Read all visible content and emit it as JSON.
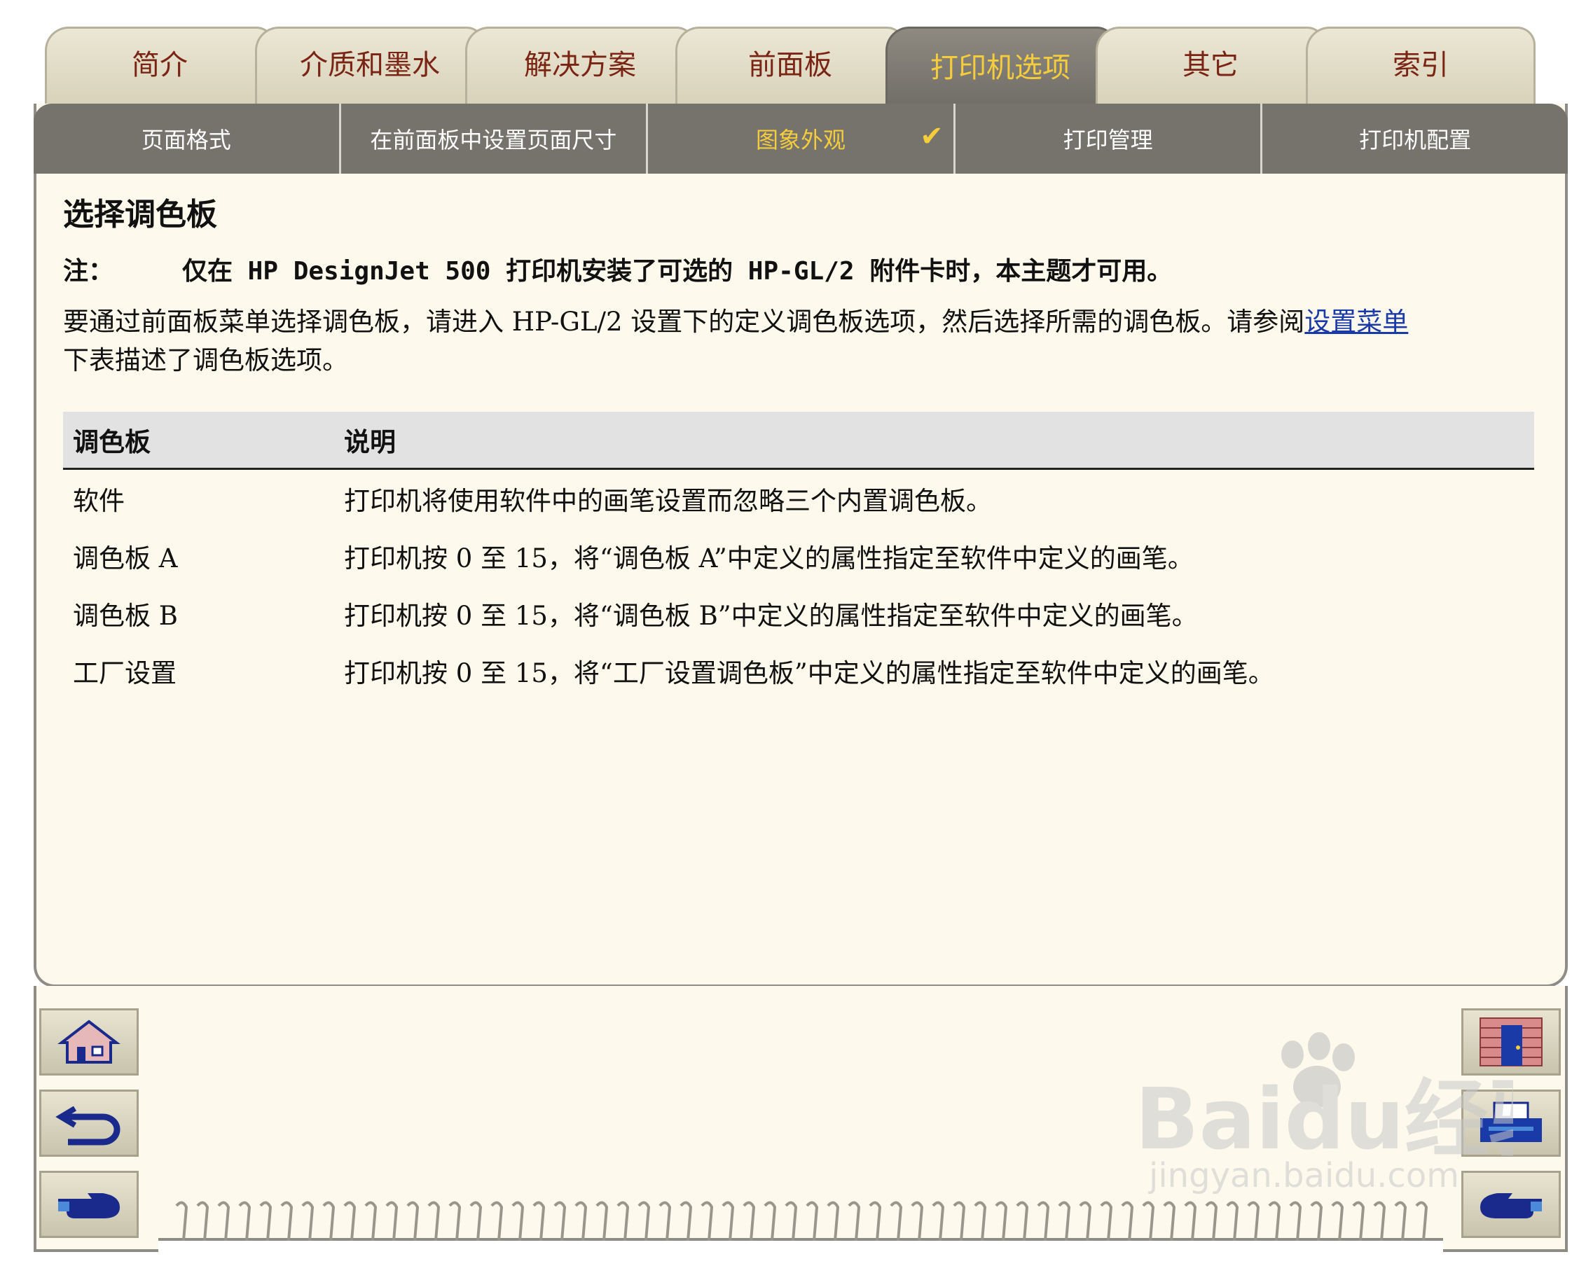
{
  "tabs": [
    {
      "label": "简介"
    },
    {
      "label": "介质和墨水"
    },
    {
      "label": "解决方案"
    },
    {
      "label": "前面板"
    },
    {
      "label": "打印机选项"
    },
    {
      "label": "其它"
    },
    {
      "label": "索引"
    }
  ],
  "subnav": [
    {
      "label": "页面格式"
    },
    {
      "label": "在前面板中设置页面尺寸"
    },
    {
      "label": "图象外观"
    },
    {
      "label": "打印管理"
    },
    {
      "label": "打印机配置"
    }
  ],
  "check_mark": "✔",
  "page": {
    "title": "选择调色板",
    "note_label": "注：",
    "note_text": "仅在 HP DesignJet 500 打印机安装了可选的 HP-GL/2 附件卡时，本主题才可用。",
    "para1_text": "要通过前面板菜单选择调色板，请进入 HP-GL/2 设置下的定义调色板选项，然后选择所需的调色板。请参阅",
    "para1_link": "设置菜单",
    "para2_text": "下表描述了调色板选项。"
  },
  "table": {
    "headers": [
      "调色板",
      "说明"
    ],
    "rows": [
      [
        "软件",
        "打印机将使用软件中的画笔设置而忽略三个内置调色板。"
      ],
      [
        "调色板 A",
        "打印机按 0 至 15，将“调色板 A”中定义的属性指定至软件中定义的画笔。"
      ],
      [
        "调色板 B",
        "打印机按 0 至 15，将“调色板 B”中定义的属性指定至软件中定义的画笔。"
      ],
      [
        "工厂设置",
        "打印机按 0 至 15，将“工厂设置调色板”中定义的属性指定至软件中定义的画笔。"
      ]
    ]
  },
  "icons": {
    "home": "home-icon",
    "back": "back-arrow-icon",
    "next": "pointing-hand-icon",
    "contents": "brick-wall-door-icon",
    "print": "printer-icon",
    "prev": "pointing-hand-left-icon"
  },
  "watermark": {
    "brand": "Baidu经验",
    "url": "jingyan.baidu.com"
  },
  "colors": {
    "tab_active_text": "#f4cc3c",
    "tab_text": "#7a2414",
    "link": "#1a3aa8",
    "panel_bg": "#fdf9ec"
  }
}
